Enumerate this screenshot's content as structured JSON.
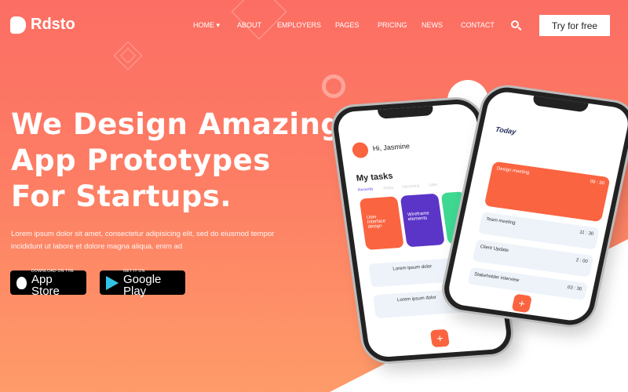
{
  "brand": {
    "name": "Rdsto"
  },
  "nav": {
    "items": [
      "HOME",
      "ABOUT",
      "EMPLOYERS",
      "PAGES",
      "PRICING",
      "NEWS",
      "CONTACT"
    ],
    "cta": "Try for free"
  },
  "hero": {
    "title_lines": [
      "We Design Amazing",
      "App Prototypes",
      "For Startups."
    ],
    "description": "Lorem ipsum dolor sit amet, consectetur adipisicing elit, sed do eiusmod tempor incididunt ut labore et dolore magna aliqua. enim ad",
    "app_store": {
      "small": "DOWNLOAD ON THE",
      "big": "App Store"
    },
    "google_play": {
      "small": "GET IT ON",
      "big": "Google Play"
    }
  },
  "phone_left": {
    "greeting": "Hi, Jasmine",
    "section": "My tasks",
    "tabs": [
      "Recently",
      "Today",
      "Upcoming",
      "Later"
    ],
    "cards": [
      "User Interface design",
      "Wireframe elements"
    ],
    "list": [
      "Lorem ipsum dolor",
      "Lorem ipsum dolor"
    ]
  },
  "phone_right": {
    "heading": "Today",
    "events": [
      {
        "title": "Design meeting",
        "time": "09 : 30"
      },
      {
        "title": "Team meeting",
        "time": "11 : 30"
      },
      {
        "title": "Client Update",
        "time": "2 : 00"
      },
      {
        "title": "Stakeholder interview",
        "time": "03 : 30"
      }
    ]
  },
  "colors": {
    "accent": "#fb6440",
    "purple": "#5b35c7",
    "green": "#3ed890"
  }
}
